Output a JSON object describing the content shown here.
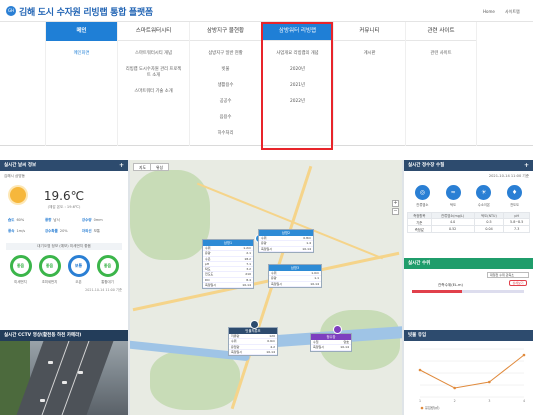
{
  "header": {
    "logo_mark": "GH",
    "title": "김해 도시 수자원 리빙랩 통합 플랫폼",
    "home": "Home",
    "sitemap": "사이트맵"
  },
  "menu": [
    {
      "label": "메인",
      "items": [
        "메인화면"
      ]
    },
    {
      "label": "스마트워터시티",
      "items": [
        "스마트워터시티 개념",
        "리빙랩 도시수자원 관리 프로젝트 소개",
        "스마트워터 기술 소개"
      ]
    },
    {
      "label": "삼방지구 물현황",
      "items": [
        "삼방지구 일반 현황",
        "빗물",
        "생활용수",
        "공공수",
        "음용수",
        "하수처리"
      ]
    },
    {
      "label": "삼방워터 리빙랩",
      "items": [
        "사업개요 리빙랩의 개념",
        "2020년",
        "2021년",
        "2022년"
      ]
    },
    {
      "label": "커뮤니티",
      "items": [
        "게시판"
      ]
    },
    {
      "label": "관련 사이트",
      "items": [
        "관련 사이트"
      ]
    }
  ],
  "weather": {
    "title": "실시간 날씨 정보",
    "location": "김해시 삼방동",
    "temperature": "19.6℃",
    "feels": "(체감 온도 : 19.6℃)",
    "stats": [
      {
        "label": "습도",
        "value": "60%"
      },
      {
        "label": "풍향",
        "value": "남서"
      },
      {
        "label": "강수량",
        "value": "0mm"
      },
      {
        "label": "풍속",
        "value": "1m/s"
      },
      {
        "label": "강수확률",
        "value": "20%"
      },
      {
        "label": "자외선",
        "value": "보통"
      }
    ],
    "air_title": "대기오염 정보 (예보) 미세먼지 좋음",
    "air": [
      {
        "value": "좋음",
        "label": "미세먼지"
      },
      {
        "value": "좋음",
        "label": "초미세먼지"
      },
      {
        "value": "보통",
        "label": "오존"
      },
      {
        "value": "좋음",
        "label": "통합대기"
      }
    ],
    "timestamp": "2021-10-14 11:00 기준"
  },
  "cctv": {
    "title": "실시간 CCTV 영상(활천동 하천 카메라)"
  },
  "map": {
    "tabs": [
      "지도",
      "위성"
    ],
    "popups": [
      {
        "title": "삼방1",
        "color": "blue",
        "rows": [
          [
            "수위",
            "1.2m"
          ],
          [
            "유량",
            "2.1"
          ],
          [
            "수온",
            "18.2"
          ],
          [
            "pH",
            "7.1"
          ],
          [
            "탁도",
            "3.2"
          ],
          [
            "전도도",
            "210"
          ],
          [
            "DO",
            "8.4"
          ],
          [
            "측정일시",
            "10-14"
          ]
        ]
      },
      {
        "title": "삼방2",
        "color": "blue",
        "rows": [
          [
            "수위",
            "0.8m"
          ],
          [
            "유량",
            "1.4"
          ],
          [
            "측정일시",
            "10-14"
          ]
        ]
      },
      {
        "title": "삼방3",
        "color": "blue",
        "rows": [
          [
            "수위",
            "1.0m"
          ],
          [
            "유량",
            "1.1"
          ],
          [
            "측정일시",
            "10-14"
          ]
        ]
      },
      {
        "title": "빗물저류조",
        "color": "navy",
        "rows": [
          [
            "저류량",
            "120"
          ],
          [
            "수위",
            "0.6m"
          ],
          [
            "유입량",
            "4.2"
          ],
          [
            "측정일시",
            "10-14"
          ]
        ]
      },
      {
        "title": "정수장",
        "color": "purple",
        "rows": [
          [
            "수질",
            "양호"
          ],
          [
            "측정일시",
            "10-14"
          ]
        ]
      }
    ]
  },
  "water": {
    "title": "실시간 정수장 수질",
    "timestamp": "2021-10-14 11:00 기준",
    "icons": [
      {
        "label": "잔류염소",
        "glyph": "◎"
      },
      {
        "label": "탁도",
        "glyph": "≈"
      },
      {
        "label": "수소이온",
        "glyph": "☀"
      },
      {
        "label": "전도도",
        "glyph": "♦"
      }
    ],
    "table": {
      "headers": [
        "측정항목",
        "잔류염소(mg/L)",
        "탁도(NTU)",
        "pH"
      ],
      "rows": [
        [
          "기준",
          "4.0",
          "0.5",
          "5.8~8.5"
        ],
        [
          "측정값",
          "0.52",
          "0.04",
          "7.3"
        ]
      ]
    }
  },
  "level": {
    "title": "실시간 수위",
    "select": "대청천 수위 관측소",
    "label": "관측수위(EL.m)",
    "button": "상세보기",
    "fill_fraction": 0.45
  },
  "rain": {
    "title": "빗물 유입",
    "legend": "유입량(㎥)",
    "chart_data": {
      "type": "line",
      "x": [
        "1",
        "2",
        "3",
        "4"
      ],
      "values": [
        9,
        3,
        5,
        14
      ],
      "ylim": [
        0,
        16
      ]
    }
  },
  "colors": {
    "primary": "#1f7fd6",
    "navy": "#2d4b6e",
    "green": "#1f9d6b",
    "highlight": "#e8242a"
  }
}
